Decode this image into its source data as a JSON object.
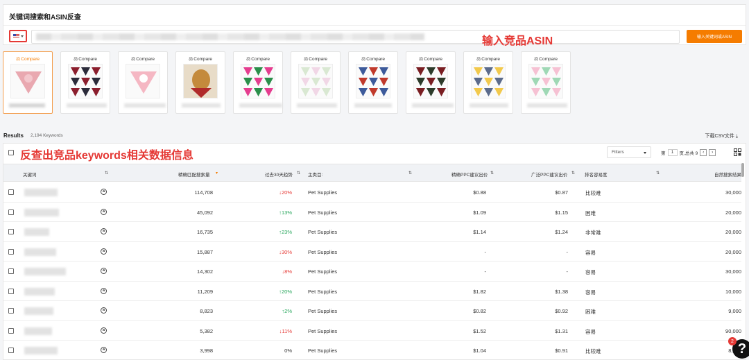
{
  "panel": {
    "title": "关键词搜索和ASIN反查",
    "annotation": "输入竞品ASIN",
    "search_button": "输入关键词或ASIN"
  },
  "cards": {
    "compare_label": "Compare",
    "items": [
      {
        "name": "product-1",
        "selected": true,
        "palette": [
          "#e9a8b0",
          "#f3c6cc"
        ]
      },
      {
        "name": "product-2",
        "selected": false,
        "palette": [
          "#8b1e2d",
          "#2b2b3a"
        ]
      },
      {
        "name": "product-3",
        "selected": false,
        "palette": [
          "#f5b7c3",
          "#ffffff"
        ]
      },
      {
        "name": "product-4",
        "selected": false,
        "palette": [
          "#c48a3c",
          "#b02a2a"
        ]
      },
      {
        "name": "product-5",
        "selected": false,
        "palette": [
          "#e53d8f",
          "#2a8f4a"
        ]
      },
      {
        "name": "product-6",
        "selected": false,
        "palette": [
          "#d9e8d2",
          "#f1d7e6"
        ]
      },
      {
        "name": "product-7",
        "selected": false,
        "palette": [
          "#3d5a9a",
          "#c0392b"
        ]
      },
      {
        "name": "product-8",
        "selected": false,
        "palette": [
          "#7a1e22",
          "#2d3b2a"
        ]
      },
      {
        "name": "product-9",
        "selected": false,
        "palette": [
          "#f2c94c",
          "#5b6b8c"
        ]
      },
      {
        "name": "product-10",
        "selected": false,
        "palette": [
          "#f6c1d3",
          "#9fd8b5"
        ]
      }
    ]
  },
  "results": {
    "label": "Results",
    "count": "2,194 Keywords",
    "download": "下载CSV文件"
  },
  "table": {
    "annotation": "反查出竞品keywords相关数据信息",
    "filters_placeholder": "Filters",
    "pager_prefix": "第",
    "page": "1",
    "pager_suffix": "页,总共 9",
    "prev": "‹",
    "next": "›",
    "headers": {
      "keyword": "关键词",
      "exact_volume": "精确匹配搜索量",
      "trend": "过去30天趋势",
      "category": "主类目:",
      "exact_ppc": "精确PPC建议出价",
      "broad_ppc": "广泛PPC建议出价",
      "difficulty": "排名容易度",
      "organic": "自然搜索结果"
    },
    "rows": [
      {
        "volume": "114,708",
        "trend": "↓20%",
        "dir": "down",
        "category": "Pet Supplies",
        "exact": "$0.88",
        "broad": "$0.87",
        "difficulty": "比较难",
        "organic": "30,000"
      },
      {
        "volume": "45,092",
        "trend": "↑13%",
        "dir": "up",
        "category": "Pet Supplies",
        "exact": "$1.09",
        "broad": "$1.15",
        "difficulty": "困难",
        "organic": "20,000"
      },
      {
        "volume": "16,735",
        "trend": "↑23%",
        "dir": "up",
        "category": "Pet Supplies",
        "exact": "$1.14",
        "broad": "$1.24",
        "difficulty": "非常难",
        "organic": "20,000"
      },
      {
        "volume": "15,887",
        "trend": "↓30%",
        "dir": "down",
        "category": "Pet Supplies",
        "exact": "-",
        "broad": "-",
        "difficulty": "容易",
        "organic": "20,000"
      },
      {
        "volume": "14,302",
        "trend": "↓8%",
        "dir": "down",
        "category": "Pet Supplies",
        "exact": "-",
        "broad": "-",
        "difficulty": "容易",
        "organic": "30,000"
      },
      {
        "volume": "11,209",
        "trend": "↑20%",
        "dir": "up",
        "category": "Pet Supplies",
        "exact": "$1.82",
        "broad": "$1.38",
        "difficulty": "容易",
        "organic": "10,000"
      },
      {
        "volume": "8,823",
        "trend": "↑2%",
        "dir": "up",
        "category": "Pet Supplies",
        "exact": "$0.82",
        "broad": "$0.92",
        "difficulty": "困难",
        "organic": "9,000"
      },
      {
        "volume": "5,382",
        "trend": "↓11%",
        "dir": "down",
        "category": "Pet Supplies",
        "exact": "$1.52",
        "broad": "$1.31",
        "difficulty": "容易",
        "organic": "90,000"
      },
      {
        "volume": "3,998",
        "trend": "0%",
        "dir": "flat",
        "category": "Pet Supplies",
        "exact": "$1.04",
        "broad": "$0.91",
        "difficulty": "比较难",
        "organic": "8,000"
      }
    ]
  },
  "help": {
    "badge": "2",
    "icon_label": "?"
  },
  "colors": {
    "accent": "#f57c00",
    "annotation": "#e53935",
    "up": "#26a65b",
    "down": "#e53935"
  }
}
